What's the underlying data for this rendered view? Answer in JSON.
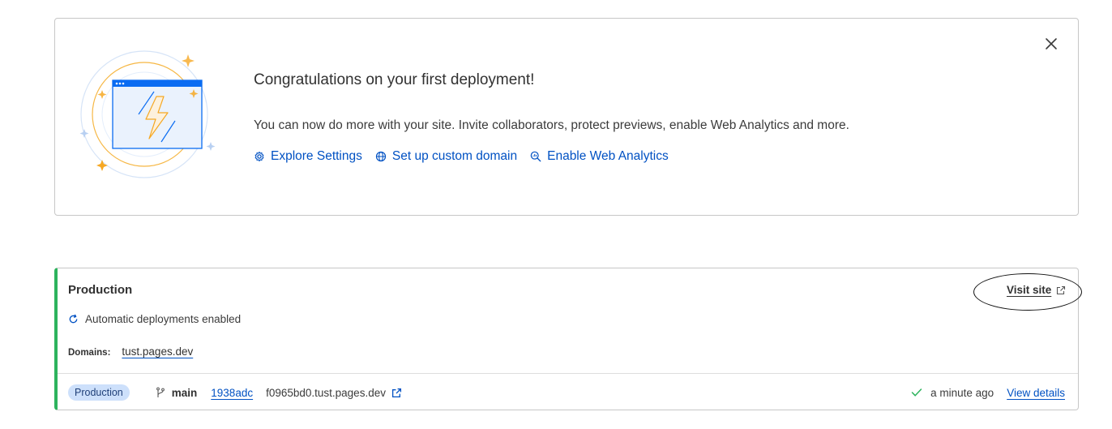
{
  "welcome": {
    "title": "Congratulations on your first deployment!",
    "description": "You can now do more with your site. Invite collaborators, protect previews, enable Web Analytics and more.",
    "links": [
      {
        "label": "Explore Settings",
        "icon": "gear-icon"
      },
      {
        "label": "Set up custom domain",
        "icon": "globe-icon"
      },
      {
        "label": "Enable Web Analytics",
        "icon": "analytics-search-icon"
      }
    ],
    "close_icon": "close-icon"
  },
  "production": {
    "title": "Production",
    "visit_site_label": "Visit site",
    "auto_deploy_text": "Automatic deployments enabled",
    "domains_label": "Domains:",
    "domain": "tust.pages.dev",
    "badge": "Production",
    "branch": "main",
    "commit": "1938adc",
    "deployment_url": "f0965bd0.tust.pages.dev",
    "time": "a minute ago",
    "view_details_label": "View details"
  },
  "colors": {
    "link": "#0051c3",
    "success": "#2db35d",
    "badge_bg": "#cde0fb",
    "illustration_accent": "#f6a823",
    "illustration_blue": "#0a6cf2"
  }
}
